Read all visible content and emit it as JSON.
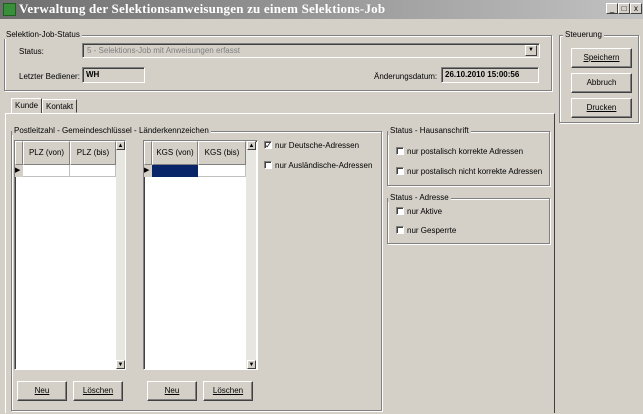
{
  "window": {
    "title": "Verwaltung der Selektionsanweisungen zu einem Selektions-Job",
    "btn_min": "_",
    "btn_max": "□",
    "btn_close": "x"
  },
  "job_status": {
    "legend": "Selektion-Job-Status",
    "status_label": "Status:",
    "status_value": "5 - Selektions-Job mit Anweisungen erfasst",
    "last_user_label": "Letzter Bediener:",
    "last_user_value": "WH",
    "changed_label": "Änderungsdatum:",
    "changed_value": "26.10.2010 15:00:56"
  },
  "steuerung": {
    "legend": "Steuerung",
    "save": "Speichern",
    "cancel": "Abbruch",
    "print": "Drucken"
  },
  "tabs": [
    {
      "label": "Kunde"
    },
    {
      "label": "Kontakt"
    }
  ],
  "plz_group": {
    "legend": "Postleitzahl - Gemeindeschlüssel - Länderkennzeichen",
    "plz_col1": "PLZ (von)",
    "plz_col2": "PLZ (bis)",
    "kgs_col1": "KGS (von)",
    "kgs_col2": "KGS (bis)",
    "new1": "Neu",
    "delete1": "Löschen",
    "new2": "Neu",
    "delete2": "Löschen",
    "cb_german": "nur Deutsche-Adressen",
    "cb_german_checked": true,
    "cb_foreign": "nur Ausländische-Adressen",
    "cb_foreign_checked": false
  },
  "haus_group": {
    "legend": "Status - Hausanschrift",
    "cb_correct": "nur postalisch korrekte Adressen",
    "cb_incorrect": "nur postalisch nicht korrekte Adressen"
  },
  "addr_group": {
    "legend": "Status - Adresse",
    "cb_active": "nur Aktive",
    "cb_blocked": "nur Gesperrte"
  },
  "colors": {
    "selected_cell": "#0a246a",
    "title_gradient_start": "#6e6e6e"
  }
}
